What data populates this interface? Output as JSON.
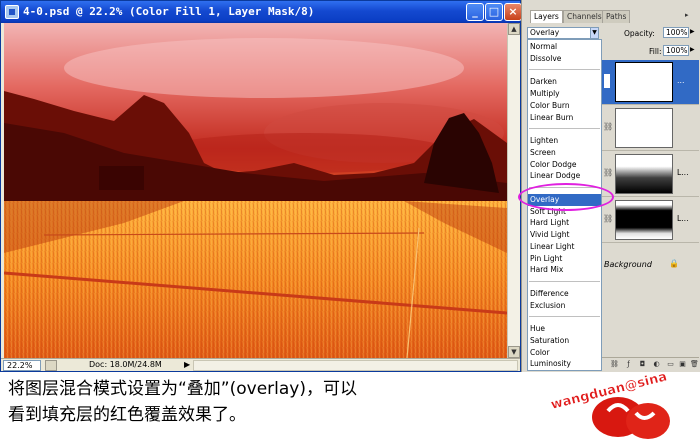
{
  "window": {
    "title": "4-0.psd @ 22.2% (Color Fill 1, Layer Mask/8)",
    "min_glyph": "_",
    "max_glyph": "□",
    "close_glyph": "×"
  },
  "status": {
    "zoom": "22.2%",
    "doc_info": "Doc: 18.0M/24.8M",
    "arrow": "▶"
  },
  "palette": {
    "tabs": [
      "Layers",
      "Channels",
      "Paths"
    ],
    "menu_glyph": "▸",
    "blend_value": "Overlay",
    "opacity_label": "Opacity:",
    "opacity_value": "100%",
    "fill_label": "Fill:",
    "fill_value": "100%",
    "blend_modes": [
      "Normal",
      "Dissolve",
      "Darken",
      "Multiply",
      "Color Burn",
      "Linear Burn",
      "Lighten",
      "Screen",
      "Color Dodge",
      "Linear Dodge",
      "Overlay",
      "Soft Light",
      "Hard Light",
      "Vivid Light",
      "Linear Light",
      "Pin Light",
      "Hard Mix",
      "Difference",
      "Exclusion",
      "Hue",
      "Saturation",
      "Color",
      "Luminosity"
    ],
    "layer_labels": [
      "…",
      "L…",
      "L…"
    ],
    "background_label": "Background"
  },
  "caption": {
    "line1": "将图层混合模式设置为“叠加”(overlay)，可以",
    "line2": "看到填充层的红色覆盖效果了。"
  },
  "logo_text": "wangduan@sina"
}
